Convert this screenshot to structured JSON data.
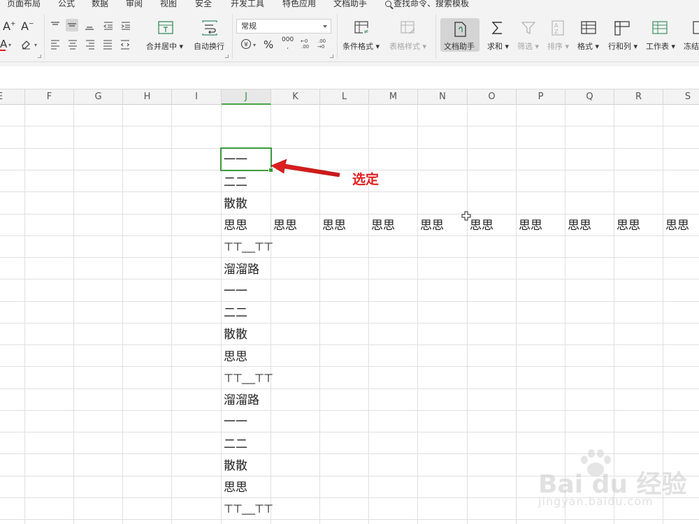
{
  "menu": {
    "tabs": [
      "页面布局",
      "公式",
      "数据",
      "审阅",
      "视图",
      "安全",
      "开发工具",
      "特色应用",
      "文档助手"
    ],
    "search_label": "查找命令、搜索模板"
  },
  "ribbon": {
    "font_grow": "A⁺",
    "font_shrink": "A⁻",
    "merge_center": "合并居中",
    "auto_wrap": "自动换行",
    "number_format": "常规",
    "percent": "%",
    "thousands": "000",
    "inc_decimal": "+0\n.00",
    "dec_decimal": ".00\n→0",
    "conditional_format": "条件格式",
    "table_style": "表格样式",
    "doc_helper": "文档助手",
    "sum": "求和",
    "filter": "筛选",
    "sort": "排序",
    "format": "格式",
    "rows_cols": "行和列",
    "worksheet": "工作表",
    "freeze": "冻结"
  },
  "sheet": {
    "columns": [
      "E",
      "F",
      "G",
      "H",
      "I",
      "J",
      "K",
      "L",
      "M",
      "N",
      "O",
      "P",
      "Q",
      "R",
      "S"
    ],
    "active_column": "J",
    "selected_cell_text": "一一",
    "column_j_values": [
      "一一",
      "二二",
      "散散",
      "思思",
      "ㄒㄒ___ㄒㄒ",
      "溜溜路",
      "一一",
      "二二",
      "散散",
      "思思",
      "ㄒㄒ___ㄒㄒ",
      "溜溜路",
      "一一",
      "二二",
      "散散",
      "思思",
      "ㄒㄒ___ㄒㄒ"
    ],
    "row_4_fill": [
      "思思",
      "思思",
      "思思",
      "思思",
      "思思",
      "思思",
      "思思",
      "思思",
      "思思"
    ]
  },
  "annotation": {
    "label": "选定",
    "color": "#e02020"
  },
  "watermark": {
    "brand": "Bai du 经验",
    "url": "jingyan.baidu.com"
  },
  "colors": {
    "selection": "#3c9a3c",
    "ribbon_bg": "#f3f3f3",
    "grid_line": "#e0e0e0"
  }
}
